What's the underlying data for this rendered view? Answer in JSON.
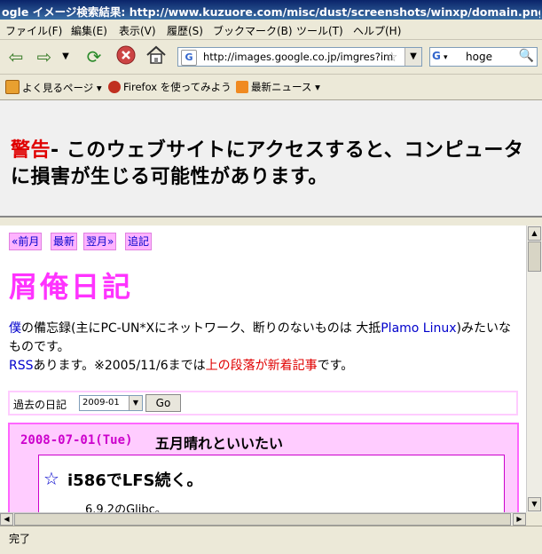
{
  "window": {
    "title": "ogle イメージ検索結果: http://www.kuzuore.com/misc/dust/screenshots/winxp/domain.png - Mo"
  },
  "menu": [
    "ファイル(F)",
    "編集(E)",
    "表示(V)",
    "履歴(S)",
    "ブックマーク(B)",
    "ツール(T)",
    "ヘルプ(H)"
  ],
  "nav": {
    "url": "http://images.google.co.jp/imgres?im",
    "search_value": "hoge",
    "search_engine": "G"
  },
  "bookmarks": [
    "よく見るページ ▾",
    "Firefox を使ってみよう",
    "最新ニュース ▾"
  ],
  "warning": {
    "label": "警告",
    "text": "- このウェブサイトにアクセスすると、コンピュータに損害が生じる可能性があります。"
  },
  "page": {
    "nav_links": [
      "«前月",
      "最新",
      "翌月»",
      "追記"
    ],
    "blog_title": "屑俺日記",
    "desc": {
      "boku": "僕",
      "part1": "の備忘録(主にPC-UN*Xにネットワーク、断りのないものは 大抵",
      "plamo": "Plamo Linux",
      "part2": ")みたいなものです。",
      "rss": "RSS",
      "part3": "あります。※2005/11/6までは",
      "red": "上の段落が新着記事",
      "part4": "です。"
    },
    "archive": {
      "label": "過去の日記",
      "selected": "2009-01",
      "go": "Go"
    },
    "entry": {
      "date": "2008-07-01(Tue)",
      "title": "五月晴れといいたい",
      "section_star": "☆",
      "section_title": "i586でLFS続く。",
      "first_line": "6.9.2のGlibc。"
    }
  },
  "status": "完了"
}
